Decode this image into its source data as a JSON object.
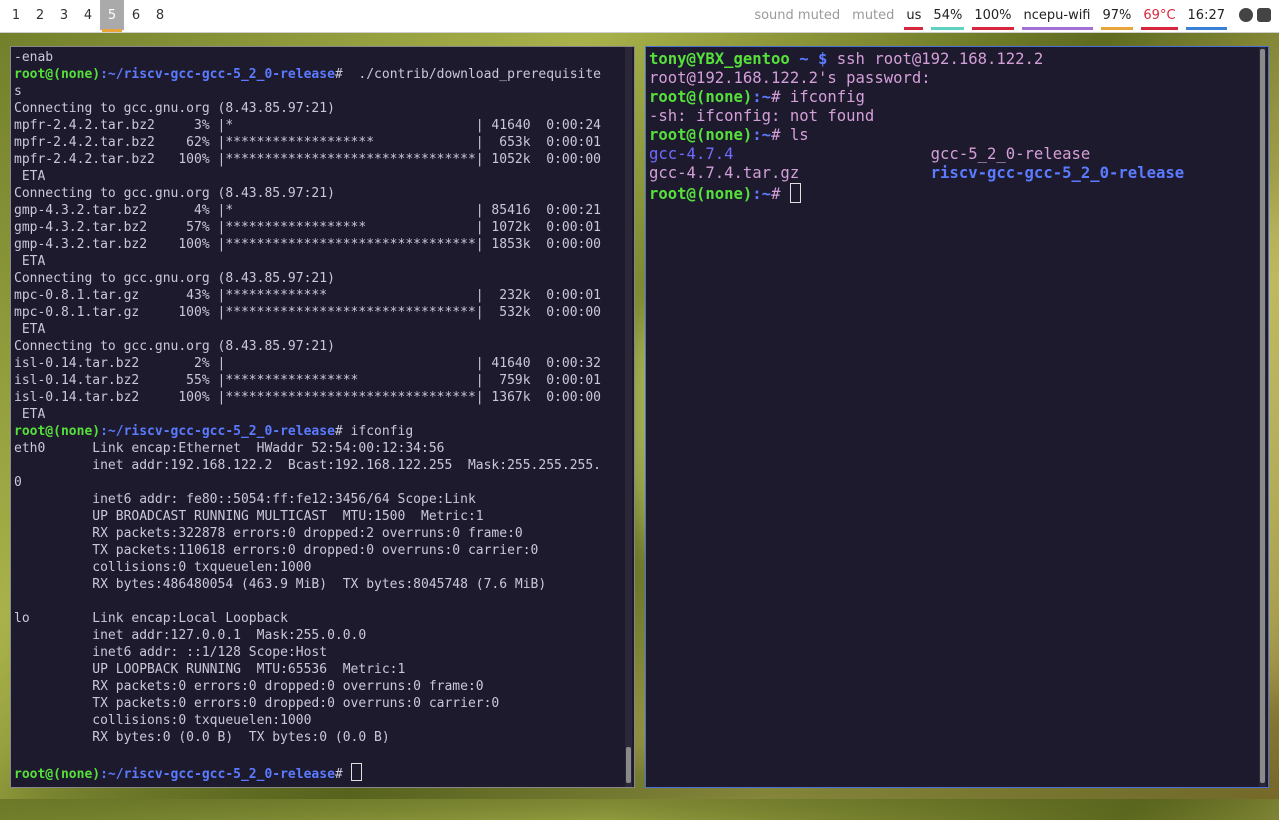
{
  "workspaces": [
    "1",
    "2",
    "3",
    "4",
    "5",
    "6",
    "8"
  ],
  "active_workspace": "5",
  "status": [
    {
      "text": "sound muted",
      "color": "#9a9a9a",
      "bar": ""
    },
    {
      "text": "muted",
      "color": "#9a9a9a",
      "bar": ""
    },
    {
      "text": "us",
      "color": "#222222",
      "bar": "#d7263d"
    },
    {
      "text": "54%",
      "color": "#222222",
      "bar": "#5fd3c2"
    },
    {
      "text": "100%",
      "color": "#222222",
      "bar": "#d7263d"
    },
    {
      "text": "ncepu-wifi",
      "color": "#222222",
      "bar": "#a66fd8"
    },
    {
      "text": "97%",
      "color": "#222222",
      "bar": "#e8a53a"
    },
    {
      "text": "69°C",
      "color": "#d7263d",
      "bar": "#d7263d"
    },
    {
      "text": "16:27",
      "color": "#222222",
      "bar": "#3a7fd8"
    }
  ],
  "left_terminal": [
    {
      "parts": [
        [
          "-enab",
          ""
        ]
      ]
    },
    {
      "parts": [
        [
          "root@(none)",
          "g"
        ],
        [
          ":~/riscv-gcc-gcc-5_2_0-release",
          "b"
        ],
        [
          "#  ./contrib/download_prerequisite",
          ""
        ]
      ]
    },
    {
      "parts": [
        [
          "s",
          ""
        ]
      ]
    },
    {
      "parts": [
        [
          "Connecting to gcc.gnu.org (8.43.85.97:21)",
          ""
        ]
      ]
    },
    {
      "parts": [
        [
          "mpfr-2.4.2.tar.bz2     3% |*                               | 41640  0:00:24",
          ""
        ]
      ]
    },
    {
      "parts": [
        [
          "mpfr-2.4.2.tar.bz2    62% |*******************             |  653k  0:00:01",
          ""
        ]
      ]
    },
    {
      "parts": [
        [
          "mpfr-2.4.2.tar.bz2   100% |********************************| 1052k  0:00:00",
          ""
        ]
      ]
    },
    {
      "parts": [
        [
          " ETA",
          ""
        ]
      ]
    },
    {
      "parts": [
        [
          "Connecting to gcc.gnu.org (8.43.85.97:21)",
          ""
        ]
      ]
    },
    {
      "parts": [
        [
          "gmp-4.3.2.tar.bz2      4% |*                               | 85416  0:00:21",
          ""
        ]
      ]
    },
    {
      "parts": [
        [
          "gmp-4.3.2.tar.bz2     57% |******************              | 1072k  0:00:01",
          ""
        ]
      ]
    },
    {
      "parts": [
        [
          "gmp-4.3.2.tar.bz2    100% |********************************| 1853k  0:00:00",
          ""
        ]
      ]
    },
    {
      "parts": [
        [
          " ETA",
          ""
        ]
      ]
    },
    {
      "parts": [
        [
          "Connecting to gcc.gnu.org (8.43.85.97:21)",
          ""
        ]
      ]
    },
    {
      "parts": [
        [
          "mpc-0.8.1.tar.gz      43% |*************                   |  232k  0:00:01",
          ""
        ]
      ]
    },
    {
      "parts": [
        [
          "mpc-0.8.1.tar.gz     100% |********************************|  532k  0:00:00",
          ""
        ]
      ]
    },
    {
      "parts": [
        [
          " ETA",
          ""
        ]
      ]
    },
    {
      "parts": [
        [
          "Connecting to gcc.gnu.org (8.43.85.97:21)",
          ""
        ]
      ]
    },
    {
      "parts": [
        [
          "isl-0.14.tar.bz2       2% |                                | 41640  0:00:32",
          ""
        ]
      ]
    },
    {
      "parts": [
        [
          "isl-0.14.tar.bz2      55% |*****************               |  759k  0:00:01",
          ""
        ]
      ]
    },
    {
      "parts": [
        [
          "isl-0.14.tar.bz2     100% |********************************| 1367k  0:00:00",
          ""
        ]
      ]
    },
    {
      "parts": [
        [
          " ETA",
          ""
        ]
      ]
    },
    {
      "parts": [
        [
          "root@(none)",
          "g"
        ],
        [
          ":~/riscv-gcc-gcc-5_2_0-release",
          "b"
        ],
        [
          "# ifconfig",
          ""
        ]
      ]
    },
    {
      "parts": [
        [
          "eth0      Link encap:Ethernet  HWaddr 52:54:00:12:34:56",
          ""
        ]
      ]
    },
    {
      "parts": [
        [
          "          inet addr:192.168.122.2  Bcast:192.168.122.255  Mask:255.255.255.",
          ""
        ]
      ]
    },
    {
      "parts": [
        [
          "0",
          ""
        ]
      ]
    },
    {
      "parts": [
        [
          "          inet6 addr: fe80::5054:ff:fe12:3456/64 Scope:Link",
          ""
        ]
      ]
    },
    {
      "parts": [
        [
          "          UP BROADCAST RUNNING MULTICAST  MTU:1500  Metric:1",
          ""
        ]
      ]
    },
    {
      "parts": [
        [
          "          RX packets:322878 errors:0 dropped:2 overruns:0 frame:0",
          ""
        ]
      ]
    },
    {
      "parts": [
        [
          "          TX packets:110618 errors:0 dropped:0 overruns:0 carrier:0",
          ""
        ]
      ]
    },
    {
      "parts": [
        [
          "          collisions:0 txqueuelen:1000",
          ""
        ]
      ]
    },
    {
      "parts": [
        [
          "          RX bytes:486480054 (463.9 MiB)  TX bytes:8045748 (7.6 MiB)",
          ""
        ]
      ]
    },
    {
      "parts": [
        [
          "",
          ""
        ]
      ]
    },
    {
      "parts": [
        [
          "lo        Link encap:Local Loopback",
          ""
        ]
      ]
    },
    {
      "parts": [
        [
          "          inet addr:127.0.0.1  Mask:255.0.0.0",
          ""
        ]
      ]
    },
    {
      "parts": [
        [
          "          inet6 addr: ::1/128 Scope:Host",
          ""
        ]
      ]
    },
    {
      "parts": [
        [
          "          UP LOOPBACK RUNNING  MTU:65536  Metric:1",
          ""
        ]
      ]
    },
    {
      "parts": [
        [
          "          RX packets:0 errors:0 dropped:0 overruns:0 frame:0",
          ""
        ]
      ]
    },
    {
      "parts": [
        [
          "          TX packets:0 errors:0 dropped:0 overruns:0 carrier:0",
          ""
        ]
      ]
    },
    {
      "parts": [
        [
          "          collisions:0 txqueuelen:1000",
          ""
        ]
      ]
    },
    {
      "parts": [
        [
          "          RX bytes:0 (0.0 B)  TX bytes:0 (0.0 B)",
          ""
        ]
      ]
    },
    {
      "parts": [
        [
          "",
          ""
        ]
      ]
    },
    {
      "parts": [
        [
          "root@(none)",
          "g"
        ],
        [
          ":~/riscv-gcc-gcc-5_2_0-release",
          "b"
        ],
        [
          "# ",
          ""
        ]
      ],
      "cursor": true
    }
  ],
  "right_terminal": [
    {
      "parts": [
        [
          "tony@YBX_gentoo",
          "g"
        ],
        [
          " ~ $",
          "b"
        ],
        [
          " ssh root@192.168.122.2",
          "pink"
        ]
      ]
    },
    {
      "parts": [
        [
          "root@192.168.122.2's password:",
          "pink"
        ]
      ]
    },
    {
      "parts": [
        [
          "root@(none)",
          "g"
        ],
        [
          ":~",
          "b"
        ],
        [
          "# ifconfig",
          "pink"
        ]
      ]
    },
    {
      "parts": [
        [
          "-sh: ifconfig: not found",
          "pink"
        ]
      ]
    },
    {
      "parts": [
        [
          "root@(none)",
          "g"
        ],
        [
          ":~",
          "b"
        ],
        [
          "# ls",
          "pink"
        ]
      ]
    },
    {
      "parts": [
        [
          "gcc-4.7.4",
          "bp"
        ],
        [
          "                     ",
          ""
        ],
        [
          "gcc-5_2_0-release",
          "pink"
        ]
      ]
    },
    {
      "parts": [
        [
          "gcc-4.7.4.tar.gz",
          "pink"
        ],
        [
          "              ",
          ""
        ],
        [
          "riscv-gcc-gcc-5_2_0-release",
          "b"
        ]
      ]
    },
    {
      "parts": [
        [
          "root@(none)",
          "g"
        ],
        [
          ":~",
          "b"
        ],
        [
          "# ",
          "pink"
        ]
      ],
      "cursor": true
    }
  ]
}
